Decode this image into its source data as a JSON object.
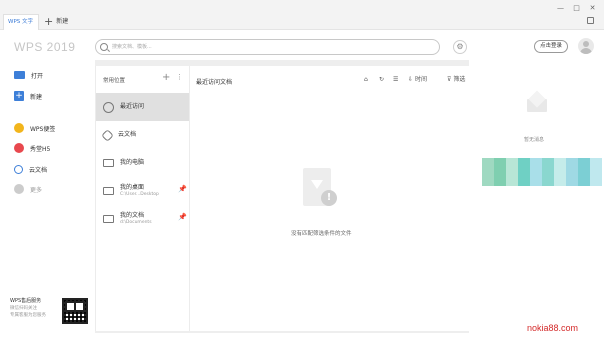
{
  "titlebar": {
    "active_tab": "WPS 文字",
    "new_tab": "新建",
    "controls": [
      "—",
      "□",
      "✕"
    ]
  },
  "header": {
    "logo": "WPS 2019",
    "search_placeholder": "搜索文档、模板...",
    "login_label": "点击登录"
  },
  "leftnav": {
    "items": [
      {
        "label": "打开",
        "icon": "folder-icon"
      },
      {
        "label": "新建",
        "icon": "plus-icon"
      },
      {
        "label": "WPS便签",
        "icon": "note-icon"
      },
      {
        "label": "秀堂H5",
        "icon": "show-icon"
      },
      {
        "label": "云文档",
        "icon": "cloud-icon"
      },
      {
        "label": "更多",
        "icon": "more-icon"
      }
    ],
    "service_title": "WPS售后服务",
    "service_sub1": "微信扫码关注",
    "service_sub2": "专属客服为您服务"
  },
  "locations": {
    "header": "常用位置",
    "items": [
      {
        "label": "最近访问",
        "path": ""
      },
      {
        "label": "云文档",
        "path": ""
      },
      {
        "label": "我的电脑",
        "path": ""
      },
      {
        "label": "我的桌面",
        "path": "C:\\User...Desktop"
      },
      {
        "label": "我的文档",
        "path": "d:\\Documents"
      }
    ]
  },
  "filelist": {
    "title": "最近访问文档",
    "time_label": "时间",
    "filter_label": "筛选",
    "empty_text": "没有匹配筛选条件的文件"
  },
  "rightpanel": {
    "no_message": "暂无消息"
  },
  "watermark": "nokia88.com",
  "colors": {
    "accent": "#3d7fd8",
    "note": "#f2b51c",
    "show": "#e8484e",
    "watermark": "#d42a2a"
  }
}
